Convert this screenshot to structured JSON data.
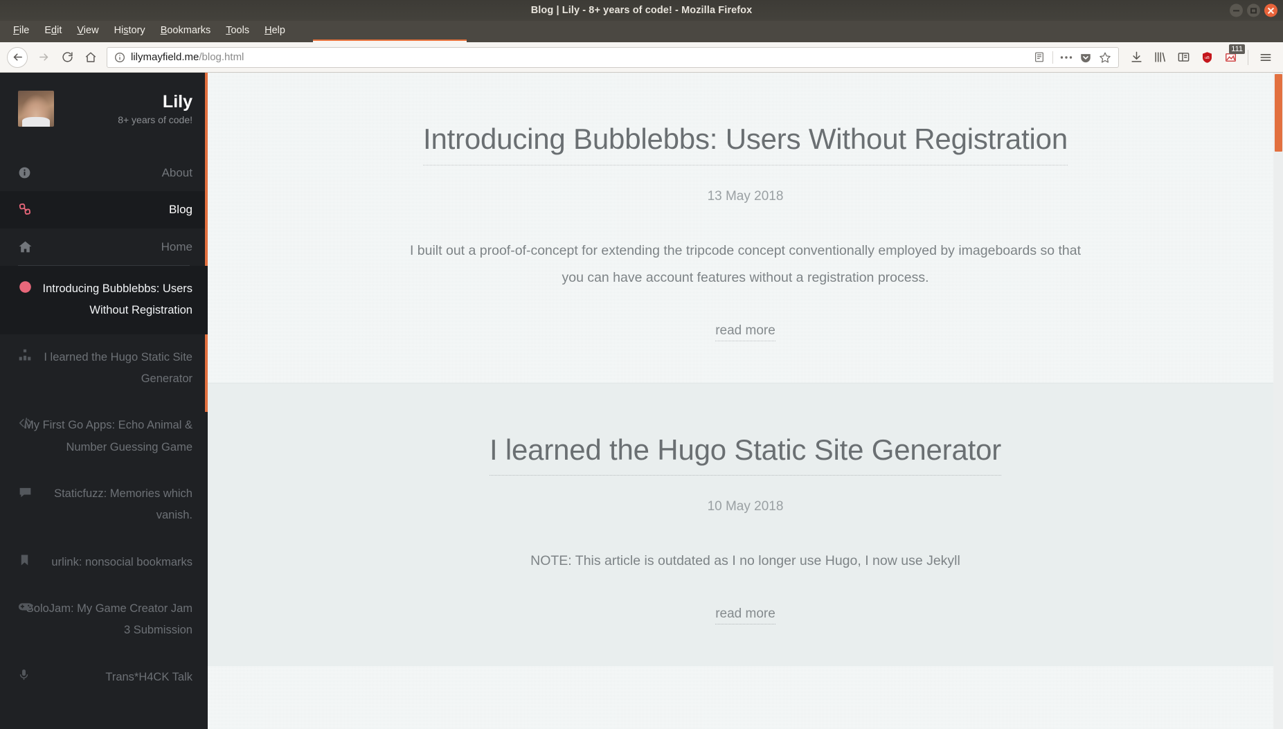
{
  "window": {
    "title": "Blog | Lily - 8+ years of code! - Mozilla Firefox",
    "controls": {
      "minimize": "minimize",
      "maximize": "maximize",
      "close": "close"
    }
  },
  "menubar": {
    "items": [
      {
        "label": "File"
      },
      {
        "label": "Edit"
      },
      {
        "label": "View"
      },
      {
        "label": "History"
      },
      {
        "label": "Bookmarks"
      },
      {
        "label": "Tools"
      },
      {
        "label": "Help"
      }
    ]
  },
  "navbar": {
    "back": "back-arrow",
    "forward": "forward-arrow",
    "reload": "reload",
    "home": "home",
    "url_host": "lilymayfield.me",
    "url_path": "/blog.html",
    "site_info_icon": "info-circle-icon",
    "reader_icon": "reader-view-icon",
    "page_actions_icon": "ellipsis-icon",
    "pocket_icon": "pocket-icon",
    "bookmark_icon": "star-icon",
    "downloads_icon": "download-icon",
    "library_icon": "library-icon",
    "sidebar_icon": "sidebar-icon",
    "ublock_icon": "ublock-shield-icon",
    "addon_icon": "addon-icon",
    "addon_badge": "111",
    "menu_icon": "hamburger-menu-icon"
  },
  "sidebar": {
    "profile": {
      "name": "Lily",
      "tagline": "8+ years of code!",
      "avatar": "profile-photo"
    },
    "nav": [
      {
        "label": "About",
        "icon": "info-icon",
        "active": false
      },
      {
        "label": "Blog",
        "icon": "link-chain-icon",
        "active": true
      },
      {
        "label": "Home",
        "icon": "house-icon",
        "active": false
      }
    ],
    "posts": [
      {
        "label": "Introducing Bubblebbs: Users Without Registration",
        "icon": "bubble-icon",
        "active": true
      },
      {
        "label": "I learned the Hugo Static Site Generator",
        "icon": "sitemap-icon",
        "active": false
      },
      {
        "label": "My First Go Apps: Echo Animal & Number Guessing Game",
        "icon": "code-icon",
        "active": false
      },
      {
        "label": "Staticfuzz: Memories which vanish.",
        "icon": "comment-icon",
        "active": false
      },
      {
        "label": "urlink: nonsocial bookmarks",
        "icon": "bookmark-icon",
        "active": false
      },
      {
        "label": "SoloJam: My Game Creator Jam 3 Submission",
        "icon": "gamepad-icon",
        "active": false
      },
      {
        "label": "Trans*H4CK Talk",
        "icon": "microphone-icon",
        "active": false
      }
    ]
  },
  "articles": [
    {
      "title": "Introducing Bubblebbs: Users Without Registration",
      "date": "13 May 2018",
      "excerpt": "I built out a proof-of-concept for extending the tripcode concept conventionally employed by imageboards so that you can have account features without a registration process.",
      "read_more": "read more"
    },
    {
      "title": "I learned the Hugo Static Site Generator",
      "date": "10 May 2018",
      "excerpt": "NOTE: This article is outdated as I no longer use Hugo, I now use Jekyll",
      "read_more": "read more"
    }
  ],
  "colors": {
    "accent": "#e2703f",
    "sidebar_bg": "#1f2124",
    "content_bg": "#eef3f3",
    "link_active": "#e8677a"
  }
}
